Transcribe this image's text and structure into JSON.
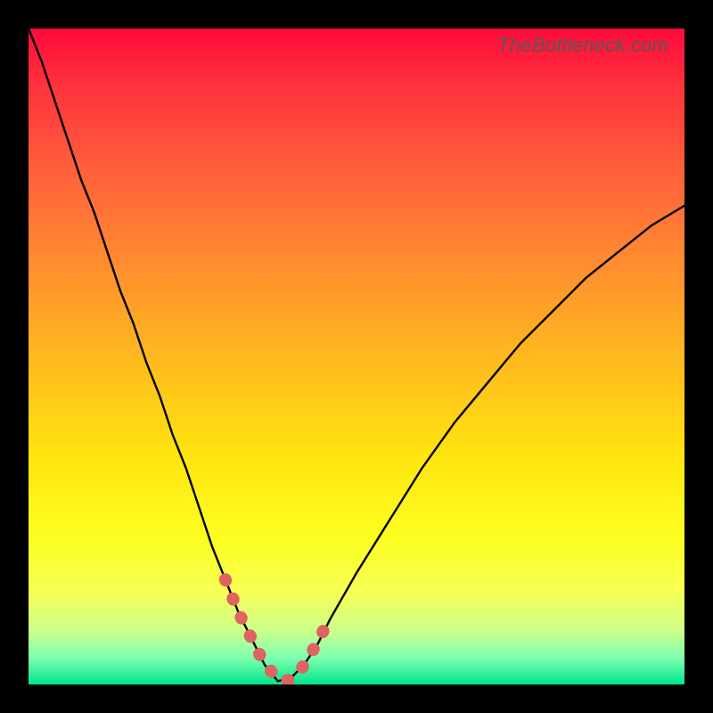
{
  "watermark": "TheBottleneck.com",
  "colors": {
    "curve": "#000000",
    "marker": "#e06262",
    "background_top": "#ff0a3c",
    "background_bottom": "#00e58a",
    "frame": "#000000"
  },
  "chart_data": {
    "type": "line",
    "title": "",
    "xlabel": "",
    "ylabel": "",
    "xlim": [
      0,
      100
    ],
    "ylim": [
      0,
      100
    ],
    "grid": false,
    "note": "V-shaped bottleneck curve over rainbow gradient; minimum near x≈38. x/y in 0–100 plot units, y=0 is bottom.",
    "series": [
      {
        "name": "bottleneck-curve",
        "x": [
          0,
          2,
          4,
          6,
          8,
          10,
          12,
          14,
          16,
          18,
          20,
          22,
          24,
          26,
          28,
          30,
          32,
          34,
          36,
          38,
          40,
          42,
          44,
          46,
          50,
          55,
          60,
          65,
          70,
          75,
          80,
          85,
          90,
          95,
          100
        ],
        "values": [
          100,
          95,
          89,
          83,
          77,
          72,
          66,
          60,
          55,
          49,
          44,
          38,
          33,
          27,
          21,
          16,
          11,
          7,
          3,
          0.5,
          1,
          3,
          6,
          10,
          17,
          25,
          33,
          40,
          46,
          52,
          57,
          62,
          66,
          70,
          73
        ]
      },
      {
        "name": "marker-segment",
        "x": [
          30,
          32,
          34,
          35,
          36,
          37,
          38,
          39,
          40,
          41,
          42,
          43,
          44,
          45,
          46
        ],
        "values": [
          16,
          11,
          7,
          5,
          3.2,
          2,
          0.9,
          0.5,
          0.8,
          1.5,
          3,
          4.5,
          6.5,
          8.3,
          10.5
        ]
      }
    ]
  }
}
